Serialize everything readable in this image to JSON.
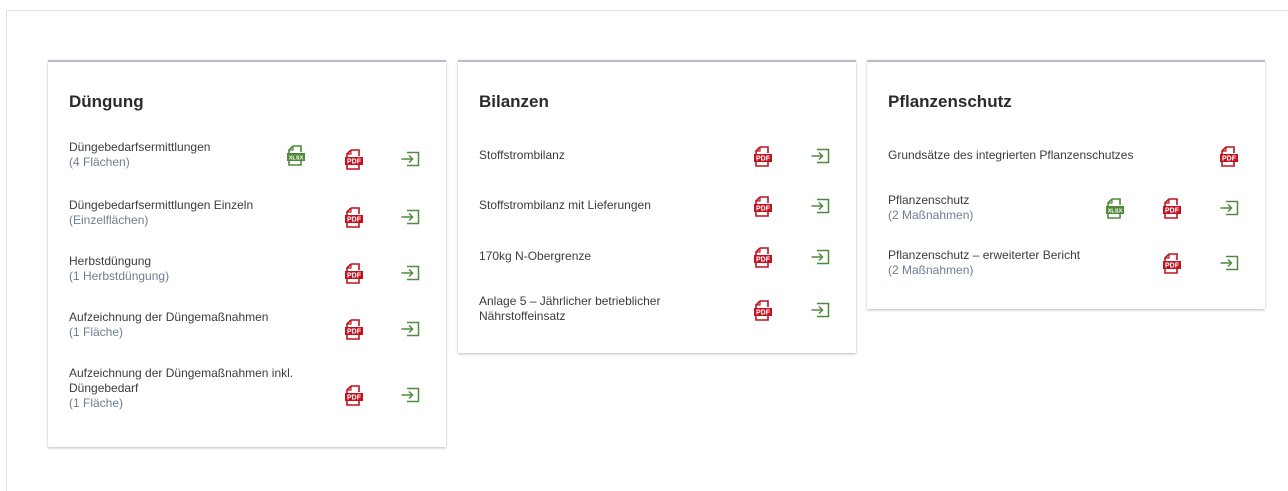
{
  "cards": [
    {
      "title": "Düngung",
      "rows": [
        {
          "label": "Düngebedarfsermittlungen",
          "sub": "(4 Flächen)",
          "icons": [
            "xlsx-icon",
            "pdf-icon",
            "export-icon"
          ]
        },
        {
          "label": "Düngebedarfsermittlungen Einzeln",
          "sub": "(Einzelflächen)",
          "icons": [
            "pdf-icon",
            "export-icon"
          ]
        },
        {
          "label": "Herbstdüngung",
          "sub": "(1 Herbstdüngung)",
          "icons": [
            "pdf-icon",
            "export-icon"
          ]
        },
        {
          "label": "Aufzeichnung der Düngemaßnahmen",
          "sub": "(1 Fläche)",
          "icons": [
            "pdf-icon",
            "export-icon"
          ]
        },
        {
          "label": "Aufzeichnung der Düngemaßnahmen inkl. Düngebedarf",
          "sub": "(1 Fläche)",
          "icons": [
            "pdf-icon",
            "export-icon"
          ]
        }
      ]
    },
    {
      "title": "Bilanzen",
      "rows": [
        {
          "label": "Stoffstrombilanz",
          "sub": "",
          "icons": [
            "pdf-icon",
            "export-icon"
          ]
        },
        {
          "label": "Stoffstrombilanz mit Lieferungen",
          "sub": "",
          "icons": [
            "pdf-icon",
            "export-icon"
          ]
        },
        {
          "label": "170kg N-Obergrenze",
          "sub": "",
          "icons": [
            "pdf-icon",
            "export-icon"
          ]
        },
        {
          "label": "Anlage 5 – Jährlicher betrieblicher Nährstoffeinsatz",
          "sub": "",
          "icons": [
            "pdf-icon",
            "export-icon"
          ]
        }
      ]
    },
    {
      "title": "Pflanzenschutz",
      "rows": [
        {
          "label": "Grundsätze des integrierten Pflanzenschutzes",
          "sub": "",
          "icons": [
            "pdf-icon"
          ]
        },
        {
          "label": "Pflanzenschutz",
          "sub": "(2 Maßnahmen)",
          "icons": [
            "xlsx-icon",
            "pdf-icon",
            "export-icon"
          ]
        },
        {
          "label": "Pflanzenschutz – erweiterter Bericht",
          "sub": "(2 Maßnahmen)",
          "icons": [
            "pdf-icon",
            "export-icon"
          ]
        }
      ]
    }
  ],
  "icon_text": {
    "pdf": "PDF",
    "xlsx": "XLSX"
  },
  "colors": {
    "pdf": "#c1121f",
    "xlsx": "#4f8a3a",
    "export": "#4f8a3a",
    "card_border": "#b8bccd"
  }
}
